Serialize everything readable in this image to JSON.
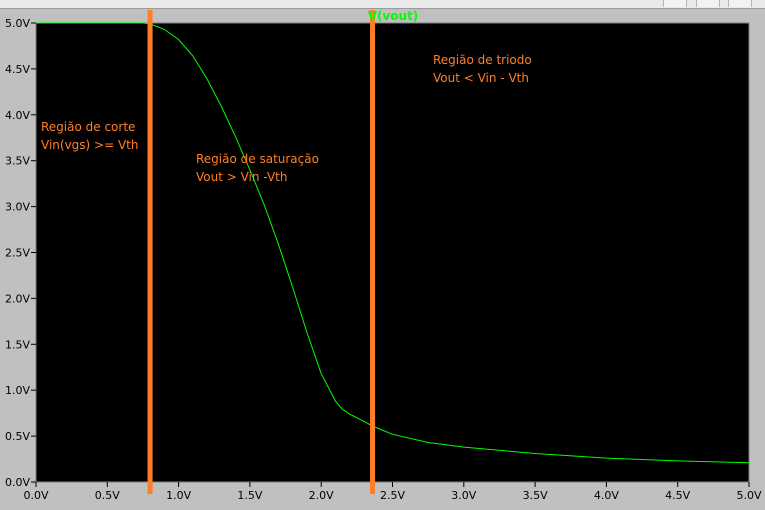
{
  "chart_data": {
    "type": "line",
    "title": "",
    "xlabel": "",
    "ylabel": "",
    "xlim": [
      0,
      5
    ],
    "ylim": [
      0,
      5
    ],
    "grid": false,
    "x_ticks": [
      "0.0V",
      "0.5V",
      "1.0V",
      "1.5V",
      "2.0V",
      "2.5V",
      "3.0V",
      "3.5V",
      "4.0V",
      "4.5V",
      "5.0V"
    ],
    "x_tick_values": [
      0,
      0.5,
      1,
      1.5,
      2,
      2.5,
      3,
      3.5,
      4,
      4.5,
      5
    ],
    "y_ticks": [
      "0.0V",
      "0.5V",
      "1.0V",
      "1.5V",
      "2.0V",
      "2.5V",
      "3.0V",
      "3.5V",
      "4.0V",
      "4.5V",
      "5.0V"
    ],
    "y_tick_values": [
      0,
      0.5,
      1,
      1.5,
      2,
      2.5,
      3,
      3.5,
      4,
      4.5,
      5
    ],
    "series": [
      {
        "name": "V(vout)",
        "color": "#00ff00",
        "x": [
          0,
          0.2,
          0.4,
          0.6,
          0.75,
          0.8,
          0.9,
          1.0,
          1.1,
          1.2,
          1.3,
          1.4,
          1.5,
          1.6,
          1.7,
          1.8,
          1.9,
          2.0,
          2.1,
          2.15,
          2.2,
          2.3,
          2.36,
          2.5,
          2.75,
          3.0,
          3.5,
          4.0,
          4.5,
          5.0
        ],
        "y": [
          5.0,
          5.0,
          5.0,
          5.0,
          5.0,
          4.99,
          4.93,
          4.82,
          4.64,
          4.39,
          4.09,
          3.76,
          3.4,
          3.02,
          2.59,
          2.12,
          1.63,
          1.18,
          0.88,
          0.79,
          0.74,
          0.66,
          0.61,
          0.52,
          0.43,
          0.38,
          0.31,
          0.26,
          0.23,
          0.21
        ]
      }
    ],
    "markers": [
      {
        "x": 0.8,
        "color": "#ff7f27"
      },
      {
        "x": 2.36,
        "color": "#ff7f27"
      }
    ],
    "annotations": [
      {
        "lines": [
          "Região de corte",
          "Vin(vgs) >= Vth"
        ],
        "color": "#ff7f27"
      },
      {
        "lines": [
          "Região de saturação",
          "Vout > Vin -Vth"
        ],
        "color": "#ff7f27"
      },
      {
        "lines": [
          "Região de triodo",
          "Vout < Vin - Vth"
        ],
        "color": "#ff7f27"
      }
    ],
    "colors": {
      "background": "#000000",
      "axes": "#808080",
      "annotation": "#ff7f27",
      "trace": "#00ff00"
    }
  }
}
